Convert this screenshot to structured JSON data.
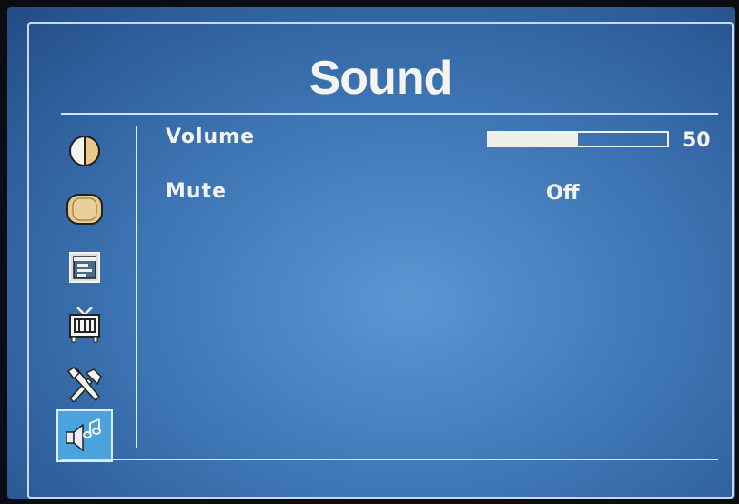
{
  "menu": {
    "title": "Sound"
  },
  "sidebar": {
    "items": [
      {
        "name": "picture",
        "icon": "contrast-icon",
        "active": false
      },
      {
        "name": "image",
        "icon": "aspect-icon",
        "active": false
      },
      {
        "name": "setup",
        "icon": "window-settings-icon",
        "active": false
      },
      {
        "name": "tv",
        "icon": "tv-icon",
        "active": false
      },
      {
        "name": "tools",
        "icon": "tools-icon",
        "active": false
      },
      {
        "name": "sound",
        "icon": "sound-icon",
        "active": true
      }
    ]
  },
  "settings": {
    "volume": {
      "label": "Volume",
      "value": "50",
      "level": 0.5
    },
    "mute": {
      "label": "Mute",
      "value": "Off"
    }
  },
  "colors": {
    "background": "#3f77b6",
    "active_item": "#4aa3dd",
    "text": "#f2f2ee"
  }
}
